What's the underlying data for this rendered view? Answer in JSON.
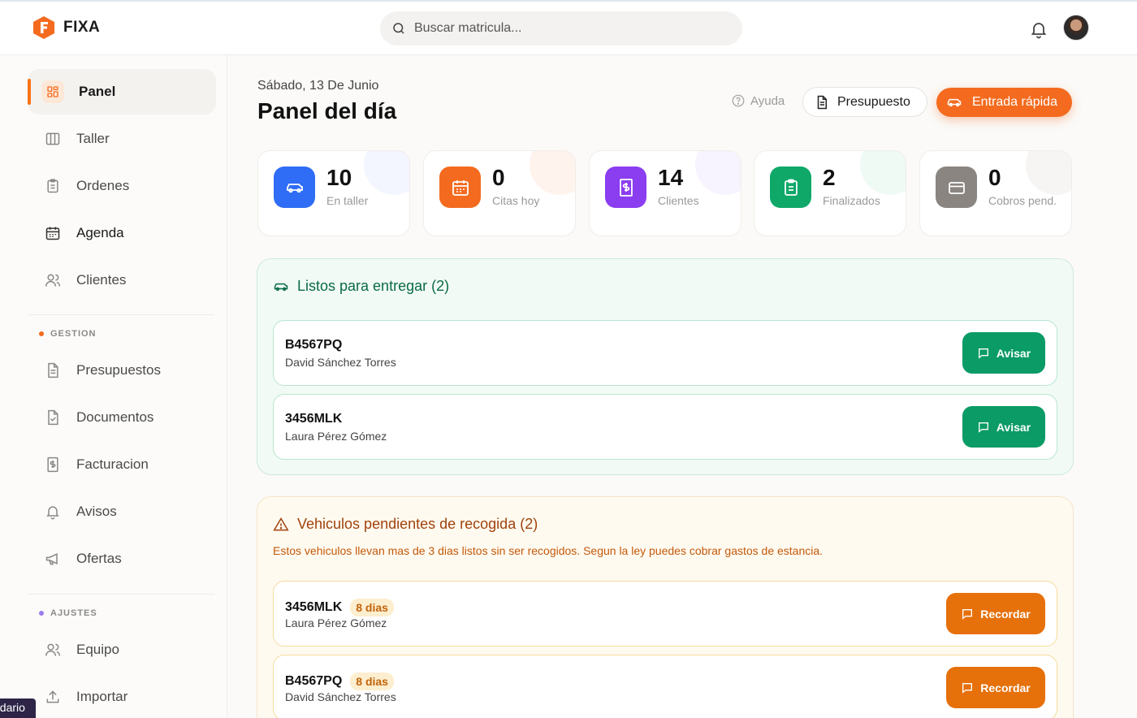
{
  "app": {
    "name": "FIXA"
  },
  "search": {
    "placeholder": "Buscar matricula..."
  },
  "icons": {
    "notifications": "bell-icon",
    "user": "avatar"
  },
  "colors": {
    "accent": "#f46b1f",
    "ready": "#0a9b66",
    "pending": "#e6700a"
  },
  "sidebar": {
    "items": [
      {
        "label": "Panel",
        "icon": "grid-icon",
        "active": true
      },
      {
        "label": "Taller",
        "icon": "columns-icon"
      },
      {
        "label": "Ordenes",
        "icon": "clipboard-icon"
      },
      {
        "label": "Agenda",
        "icon": "calendar-icon"
      },
      {
        "label": "Clientes",
        "icon": "users-icon"
      }
    ],
    "gestion_label": "GESTION",
    "gestion": [
      {
        "label": "Presupuestos",
        "icon": "file-text-icon"
      },
      {
        "label": "Documentos",
        "icon": "file-check-icon"
      },
      {
        "label": "Facturacion",
        "icon": "receipt-icon"
      },
      {
        "label": "Avisos",
        "icon": "bell-icon"
      },
      {
        "label": "Ofertas",
        "icon": "megaphone-icon"
      }
    ],
    "ajustes_label": "AJUSTES",
    "ajustes": [
      {
        "label": "Equipo",
        "icon": "users-icon"
      },
      {
        "label": "Importar",
        "icon": "upload-icon"
      }
    ],
    "calendar_chip": "ndario"
  },
  "header": {
    "date": "Sábado, 13 De Junio",
    "title": "Panel del día",
    "help": "Ayuda",
    "budget": "Presupuesto",
    "quick_entry": "Entrada rápida"
  },
  "stats": [
    {
      "value": "10",
      "label": "En taller",
      "color": "#2f6df6"
    },
    {
      "value": "0",
      "label": "Citas hoy",
      "color": "#f46b1f"
    },
    {
      "value": "14",
      "label": "Clientes",
      "color": "#8b3df0"
    },
    {
      "value": "2",
      "label": "Finalizados",
      "color": "#0a9b66"
    },
    {
      "value": "0",
      "label": "Cobros pend.",
      "color": "#8a8580"
    }
  ],
  "ready": {
    "title": "Listos para entregar (2)",
    "button": "Avisar",
    "rows": [
      {
        "plate": "B4567PQ",
        "owner": "David Sánchez Torres"
      },
      {
        "plate": "3456MLK",
        "owner": "Laura Pérez Gómez"
      }
    ]
  },
  "pending": {
    "title": "Vehiculos pendientes de recogida (2)",
    "note": "Estos vehiculos llevan mas de 3 dias listos sin ser recogidos. Segun la ley puedes cobrar gastos de estancia.",
    "button": "Recordar",
    "rows": [
      {
        "plate": "3456MLK",
        "days": "8 dias",
        "owner": "Laura Pérez Gómez"
      },
      {
        "plate": "B4567PQ",
        "days": "8 dias",
        "owner": "David Sánchez Torres"
      }
    ]
  }
}
